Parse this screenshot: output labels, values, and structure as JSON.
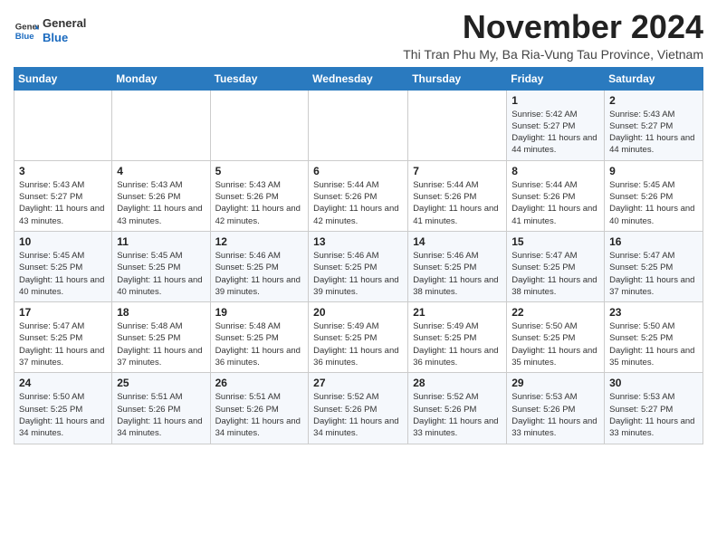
{
  "logo": {
    "line1": "General",
    "line2": "Blue"
  },
  "header": {
    "month": "November 2024",
    "location": "Thi Tran Phu My, Ba Ria-Vung Tau Province, Vietnam"
  },
  "days_of_week": [
    "Sunday",
    "Monday",
    "Tuesday",
    "Wednesday",
    "Thursday",
    "Friday",
    "Saturday"
  ],
  "weeks": [
    [
      {
        "day": "",
        "info": ""
      },
      {
        "day": "",
        "info": ""
      },
      {
        "day": "",
        "info": ""
      },
      {
        "day": "",
        "info": ""
      },
      {
        "day": "",
        "info": ""
      },
      {
        "day": "1",
        "info": "Sunrise: 5:42 AM\nSunset: 5:27 PM\nDaylight: 11 hours and 44 minutes."
      },
      {
        "day": "2",
        "info": "Sunrise: 5:43 AM\nSunset: 5:27 PM\nDaylight: 11 hours and 44 minutes."
      }
    ],
    [
      {
        "day": "3",
        "info": "Sunrise: 5:43 AM\nSunset: 5:27 PM\nDaylight: 11 hours and 43 minutes."
      },
      {
        "day": "4",
        "info": "Sunrise: 5:43 AM\nSunset: 5:26 PM\nDaylight: 11 hours and 43 minutes."
      },
      {
        "day": "5",
        "info": "Sunrise: 5:43 AM\nSunset: 5:26 PM\nDaylight: 11 hours and 42 minutes."
      },
      {
        "day": "6",
        "info": "Sunrise: 5:44 AM\nSunset: 5:26 PM\nDaylight: 11 hours and 42 minutes."
      },
      {
        "day": "7",
        "info": "Sunrise: 5:44 AM\nSunset: 5:26 PM\nDaylight: 11 hours and 41 minutes."
      },
      {
        "day": "8",
        "info": "Sunrise: 5:44 AM\nSunset: 5:26 PM\nDaylight: 11 hours and 41 minutes."
      },
      {
        "day": "9",
        "info": "Sunrise: 5:45 AM\nSunset: 5:26 PM\nDaylight: 11 hours and 40 minutes."
      }
    ],
    [
      {
        "day": "10",
        "info": "Sunrise: 5:45 AM\nSunset: 5:25 PM\nDaylight: 11 hours and 40 minutes."
      },
      {
        "day": "11",
        "info": "Sunrise: 5:45 AM\nSunset: 5:25 PM\nDaylight: 11 hours and 40 minutes."
      },
      {
        "day": "12",
        "info": "Sunrise: 5:46 AM\nSunset: 5:25 PM\nDaylight: 11 hours and 39 minutes."
      },
      {
        "day": "13",
        "info": "Sunrise: 5:46 AM\nSunset: 5:25 PM\nDaylight: 11 hours and 39 minutes."
      },
      {
        "day": "14",
        "info": "Sunrise: 5:46 AM\nSunset: 5:25 PM\nDaylight: 11 hours and 38 minutes."
      },
      {
        "day": "15",
        "info": "Sunrise: 5:47 AM\nSunset: 5:25 PM\nDaylight: 11 hours and 38 minutes."
      },
      {
        "day": "16",
        "info": "Sunrise: 5:47 AM\nSunset: 5:25 PM\nDaylight: 11 hours and 37 minutes."
      }
    ],
    [
      {
        "day": "17",
        "info": "Sunrise: 5:47 AM\nSunset: 5:25 PM\nDaylight: 11 hours and 37 minutes."
      },
      {
        "day": "18",
        "info": "Sunrise: 5:48 AM\nSunset: 5:25 PM\nDaylight: 11 hours and 37 minutes."
      },
      {
        "day": "19",
        "info": "Sunrise: 5:48 AM\nSunset: 5:25 PM\nDaylight: 11 hours and 36 minutes."
      },
      {
        "day": "20",
        "info": "Sunrise: 5:49 AM\nSunset: 5:25 PM\nDaylight: 11 hours and 36 minutes."
      },
      {
        "day": "21",
        "info": "Sunrise: 5:49 AM\nSunset: 5:25 PM\nDaylight: 11 hours and 36 minutes."
      },
      {
        "day": "22",
        "info": "Sunrise: 5:50 AM\nSunset: 5:25 PM\nDaylight: 11 hours and 35 minutes."
      },
      {
        "day": "23",
        "info": "Sunrise: 5:50 AM\nSunset: 5:25 PM\nDaylight: 11 hours and 35 minutes."
      }
    ],
    [
      {
        "day": "24",
        "info": "Sunrise: 5:50 AM\nSunset: 5:25 PM\nDaylight: 11 hours and 34 minutes."
      },
      {
        "day": "25",
        "info": "Sunrise: 5:51 AM\nSunset: 5:26 PM\nDaylight: 11 hours and 34 minutes."
      },
      {
        "day": "26",
        "info": "Sunrise: 5:51 AM\nSunset: 5:26 PM\nDaylight: 11 hours and 34 minutes."
      },
      {
        "day": "27",
        "info": "Sunrise: 5:52 AM\nSunset: 5:26 PM\nDaylight: 11 hours and 34 minutes."
      },
      {
        "day": "28",
        "info": "Sunrise: 5:52 AM\nSunset: 5:26 PM\nDaylight: 11 hours and 33 minutes."
      },
      {
        "day": "29",
        "info": "Sunrise: 5:53 AM\nSunset: 5:26 PM\nDaylight: 11 hours and 33 minutes."
      },
      {
        "day": "30",
        "info": "Sunrise: 5:53 AM\nSunset: 5:27 PM\nDaylight: 11 hours and 33 minutes."
      }
    ]
  ]
}
